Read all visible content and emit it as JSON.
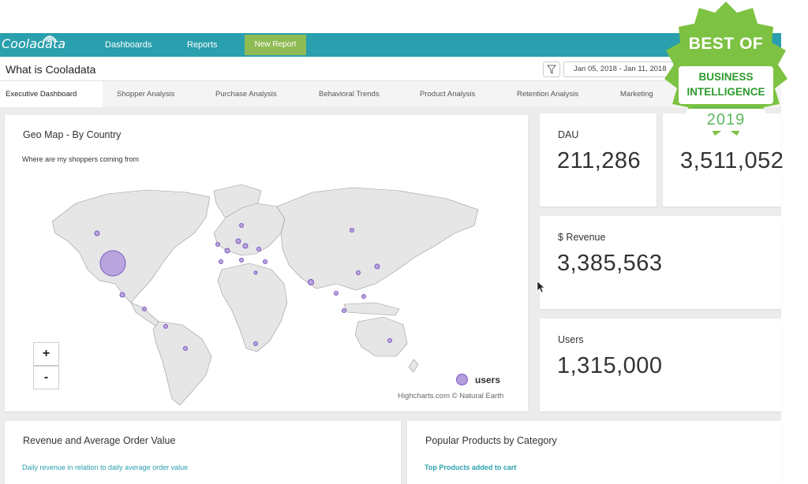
{
  "app": {
    "logo_text": "Cooladata",
    "nav": [
      "Dashboards",
      "Reports"
    ],
    "new_report": "New Report"
  },
  "page": {
    "title": "What is Cooladata",
    "date_range": "Jan 05, 2018 - Jan 11, 2018"
  },
  "tabs": [
    {
      "label": "Executive Dashboard",
      "active": true
    },
    {
      "label": "Shopper Analysis",
      "active": false
    },
    {
      "label": "Purchase Analysis",
      "active": false
    },
    {
      "label": "Behavioral Trends",
      "active": false
    },
    {
      "label": "Product Analysis",
      "active": false
    },
    {
      "label": "Retention Analysis",
      "active": false
    },
    {
      "label": "Marketing",
      "active": false
    }
  ],
  "map_card": {
    "title": "Geo Map - By Country",
    "subtitle": "Where are my shoppers coming from",
    "zoom_in": "+",
    "zoom_out": "-",
    "legend": "users",
    "credits": "Highcharts.com © Natural Earth",
    "bubble_color": "#b39ddb"
  },
  "stats": {
    "dau": {
      "label": "DAU",
      "value": "211,286"
    },
    "second": {
      "value": "3,511,052"
    },
    "revenue": {
      "label": "$ Revenue",
      "value": "3,385,563"
    },
    "users": {
      "label": "Users",
      "value": "1,315,000"
    }
  },
  "bottom": {
    "revenue_card": {
      "title": "Revenue and Average Order Value",
      "subtitle": "Daily revenue in relation to daily average order value"
    },
    "products_card": {
      "title": "Popular Products by Category",
      "subtitle": "Top Products added to cart"
    }
  },
  "badge": {
    "line1": "BEST OF",
    "line2": "BUSINESS",
    "line3": "INTELLIGENCE",
    "year": "2019",
    "color": "#7dc242"
  },
  "colors": {
    "topbar": "#2a9fad",
    "accent_green": "#8fbb55",
    "background": "#ececec"
  }
}
